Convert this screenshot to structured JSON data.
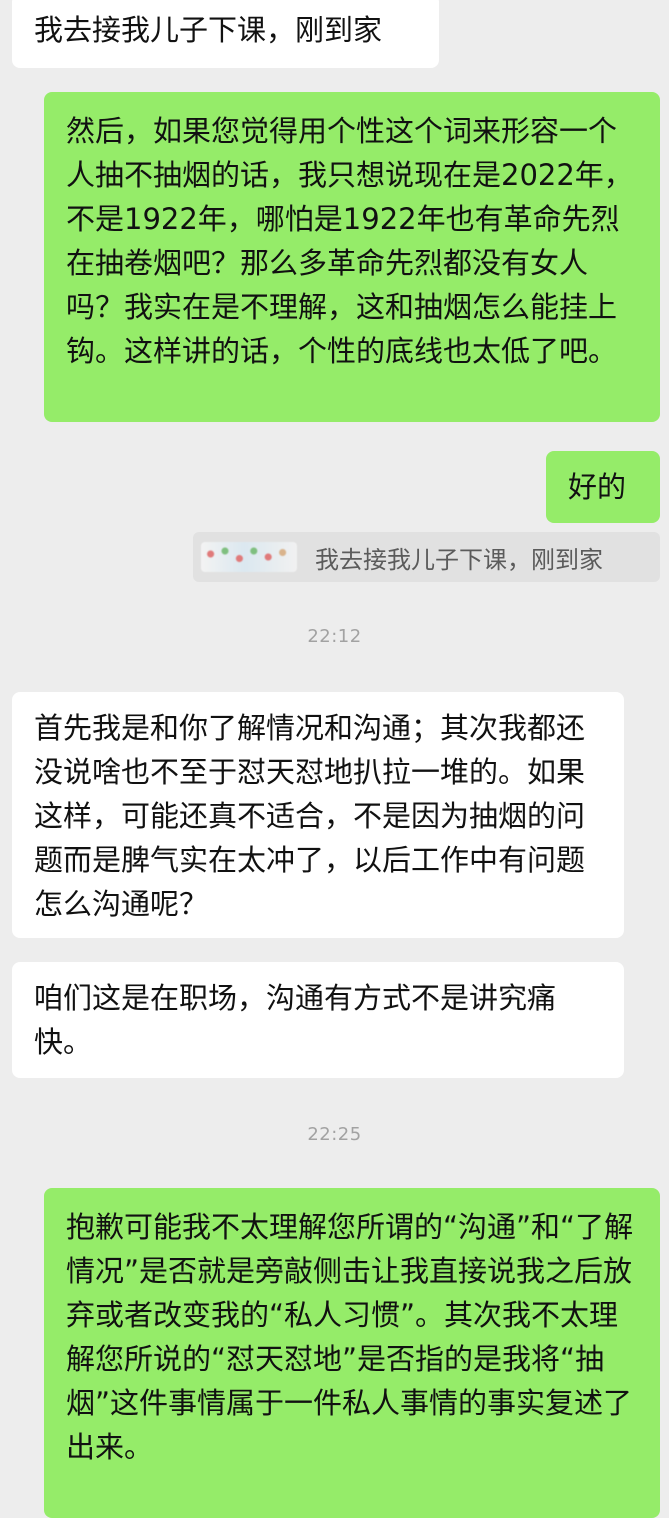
{
  "messages": [
    {
      "text": "我去接我儿子下课，刚到家"
    },
    {
      "text": "然后，如果您觉得用个性这个词来形容一个人抽不抽烟的话，我只想说现在是2022年，不是1922年，哪怕是1922年也有革命先烈在抽卷烟吧？那么多革命先烈都没有女人吗？我实在是不理解，这和抽烟怎么能挂上钩。这样讲的话，个性的底线也太低了吧。"
    },
    {
      "text": "好的"
    },
    {
      "quote_text": "我去接我儿子下课，刚到家"
    },
    {
      "time": "22:12"
    },
    {
      "text": "首先我是和你了解情况和沟通；其次我都还没说啥也不至于怼天怼地扒拉一堆的。如果这样，可能还真不适合，不是因为抽烟的问题而是脾气实在太冲了，以后工作中有问题怎么沟通呢？"
    },
    {
      "text": "咱们这是在职场，沟通有方式不是讲究痛快。"
    },
    {
      "time": "22:25"
    },
    {
      "text": "抱歉可能我不太理解您所谓的“沟通”和“了解情况”是否就是旁敲侧击让我直接说我之后放弃或者改变我的“私人习惯”。其次我不太理解您所说的“怼天怼地”是否指的是我将“抽烟”这件事情属于一件私人事情的事实复述了出来。"
    }
  ],
  "colors": {
    "background": "#ededed",
    "incoming_bubble": "#ffffff",
    "outgoing_bubble": "#95ec69",
    "quote_background": "#e1e1e1",
    "timestamp_text": "#a2a2a2"
  }
}
